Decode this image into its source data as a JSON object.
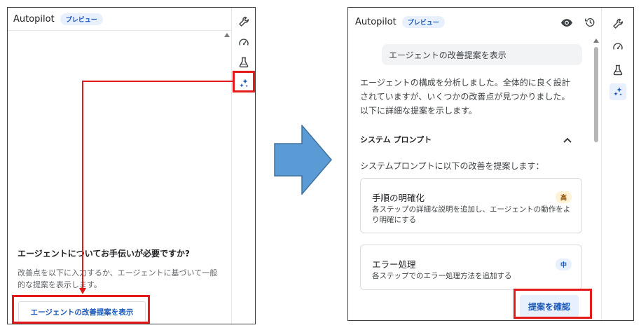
{
  "left_panel": {
    "title": "Autopilot",
    "badge": "プレビュー",
    "help": {
      "title": "エージェントについてお手伝いが必要ですか?",
      "body": "改善点を以下に入力するか、エージェントに基づいて一般的な提案を表示します。",
      "button_label": "エージェントの改善提案を表示"
    },
    "rail_icons": [
      "wrench-icon",
      "gauge-icon",
      "flask-icon",
      "sparkle-icon"
    ]
  },
  "right_panel": {
    "title": "Autopilot",
    "badge": "プレビュー",
    "header_icons": [
      "eye-icon",
      "history-icon"
    ],
    "user_message": "エージェントの改善提案を表示",
    "assistant_message": "エージェントの構成を分析しました。全体的に良く設計されていますが、いくつかの改善点が見つかりました。以下に詳細な提案を示します。",
    "section": {
      "title": "システム プロンプト",
      "description": "システムプロンプトに以下の改善を提案します："
    },
    "cards": [
      {
        "title": "手順の明確化",
        "body": "各ステップの詳細な説明を追加し、エージェントの動作をより明確にする",
        "priority": "高"
      },
      {
        "title": "エラー処理",
        "body": "各ステップでのエラー処理方法を追加する",
        "priority": "中"
      }
    ],
    "confirm_label": "提案を確認",
    "rail_icons": [
      "wrench-icon",
      "gauge-icon",
      "flask-icon",
      "sparkle-icon"
    ]
  },
  "colors": {
    "accent": "#1a57b8",
    "highlight": "#e3191a",
    "arrow_fill": "#5b9bd5",
    "arrow_stroke": "#41719c"
  }
}
